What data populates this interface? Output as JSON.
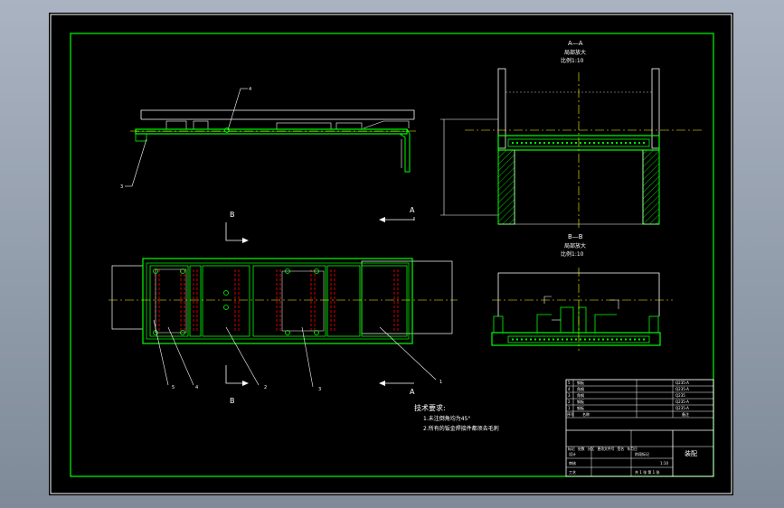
{
  "sheet": {
    "colors": {
      "background": "#000000",
      "frame": "#ffffff",
      "outline": "#00ff00",
      "centerline": "#ffff00",
      "hidden": "#ff0000",
      "dimension": "#ffffff",
      "hatch": "#00ff00"
    }
  },
  "views": {
    "section_aa": {
      "title": "A—A",
      "subtitle": "局部放大",
      "scale": "比例1:10"
    },
    "section_bb": {
      "title": "B—B",
      "subtitle": "局部放大",
      "scale": "比例1:10"
    },
    "cut_labels": {
      "b_top": "B",
      "b_bottom": "B",
      "a_top": "A",
      "a_bottom": "A"
    }
  },
  "balloons": {
    "front": [
      "4",
      "3"
    ],
    "plan": [
      "5",
      "4",
      "2",
      "3",
      "1"
    ]
  },
  "tech": {
    "title": "技术要求:",
    "items": [
      "1.未注倒角均为45°",
      "2.所有的钣金焊接件都须去毛刺"
    ]
  },
  "title_block": {
    "drawing_name": "装配",
    "parts_list": [
      {
        "no": "5",
        "name": "钢板",
        "note": "Q235-A"
      },
      {
        "no": "4",
        "name": "角钢",
        "note": "Q235-A"
      },
      {
        "no": "3",
        "name": "角钢",
        "note": "Q235"
      },
      {
        "no": "2",
        "name": "钢板",
        "note": "Q235-A"
      },
      {
        "no": "1",
        "name": "钢板",
        "note": "Q235-A"
      }
    ],
    "header": {
      "no": "序号",
      "name": "名称",
      "note": "备注"
    },
    "sign_labels": [
      "标记",
      "处数",
      "分区",
      "更改文件号",
      "签名",
      "年月日"
    ],
    "roles": [
      "设计",
      "审核",
      "工艺"
    ],
    "stage": "阶段标记",
    "sheet_info": "共 1 张 第 1 张",
    "scale_label": "1:10"
  }
}
